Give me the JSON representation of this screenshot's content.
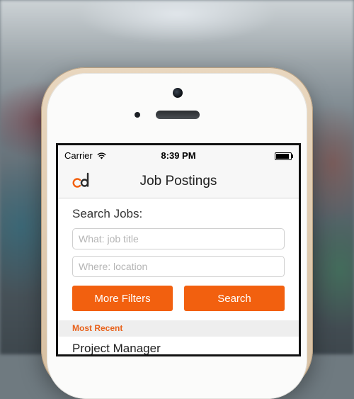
{
  "status_bar": {
    "carrier": "Carrier",
    "time": "8:39 PM"
  },
  "nav": {
    "title": "Job Postings",
    "logo_icon": "cd-logo-icon"
  },
  "search": {
    "label": "Search Jobs:",
    "what_placeholder": "What: job title",
    "where_placeholder": "Where: location"
  },
  "buttons": {
    "more_filters": "More Filters",
    "search": "Search"
  },
  "list": {
    "section_title": "Most Recent",
    "items": [
      {
        "title": "Project Manager"
      }
    ]
  },
  "colors": {
    "accent": "#f2600f",
    "section_text": "#e8611a"
  }
}
